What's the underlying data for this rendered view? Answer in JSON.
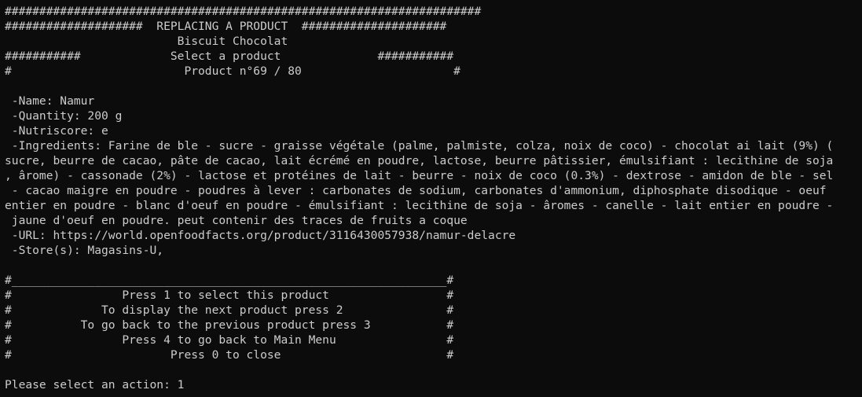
{
  "header": {
    "border_top": "#####################################################################",
    "title_line": "####################  REPLACING A PRODUCT  #####################",
    "category_line": "                         Biscuit Chocolat",
    "select_line": "###########             Select a product              ###########",
    "counter_line": "#                         Product n°69 / 80                      #"
  },
  "product": {
    "name_line": " -Name: Namur",
    "quantity_line": " -Quantity: 200 g",
    "nutriscore_line": " -Nutriscore: e",
    "ingredients_lines": [
      " -Ingredients: Farine de ble - sucre - graisse végétale (palme, palmiste, colza, noix de coco) - chocolat ai lait (9%) (",
      "sucre, beurre de cacao, pâte de cacao, lait écrémé en poudre, lactose, beurre pâtissier, émulsifiant : lecithine de soja",
      ", ârome) - cassonade (2%) - lactose et protéines de lait - beurre - noix de coco (0.3%) - dextrose - amidon de ble - sel",
      " - cacao maigre en poudre - poudres à lever : carbonates de sodium, carbonates d'ammonium, diphosphate disodique - oeuf",
      "entier en poudre - blanc d'oeuf en poudre - émulsifiant : lecithine de soja - âromes - canelle - lait entier en poudre -",
      " jaune d'oeuf en poudre. peut contenir des traces de fruits a coque"
    ],
    "url_line": " -URL: https://world.openfoodfacts.org/product/3116430057938/namur-delacre",
    "stores_line": " -Store(s): Magasins-U,"
  },
  "menu": {
    "border_line": "#_______________________________________________________________#",
    "option_1": "#                Press 1 to select this product                 #",
    "option_2": "#             To display the next product press 2               #",
    "option_3": "#          To go back to the previous product press 3           #",
    "option_4": "#                Press 4 to go back to Main Menu                #",
    "option_0": "#                       Press 0 to close                        #"
  },
  "prompt": {
    "label": "Please select an action: ",
    "value": "1"
  }
}
